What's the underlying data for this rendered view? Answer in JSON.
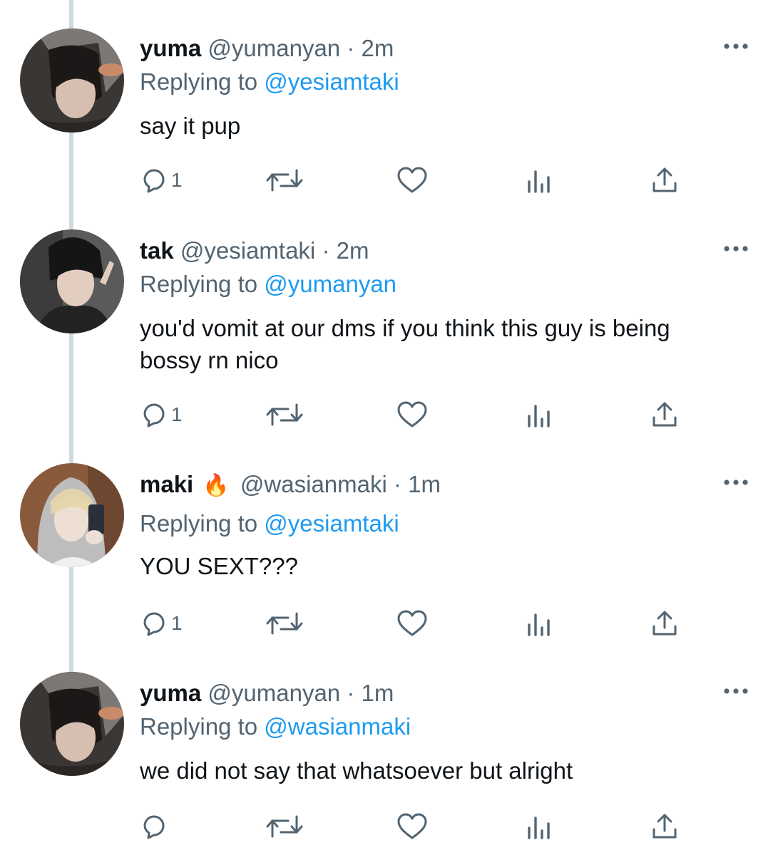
{
  "tweets": [
    {
      "name": "yuma",
      "handle": "@yumanyan",
      "time": "2m",
      "replying_prefix": "Replying to",
      "replying_to": "@yesiamtaki",
      "text": "say it pup",
      "reply_count": "1",
      "avatar": "photo of dark-haired person in grey hoodie"
    },
    {
      "name": "tak",
      "handle": "@yesiamtaki",
      "time": "2m",
      "replying_prefix": "Replying to",
      "replying_to": "@yumanyan",
      "text": "you'd vomit at our dms if you think this guy is being bossy rn nico",
      "reply_count": "1",
      "avatar": "photo of dark-haired person making peace sign"
    },
    {
      "name": "maki",
      "name_emoji": "🔥",
      "handle": "@wasianmaki",
      "time": "1m",
      "replying_prefix": "Replying to",
      "replying_to": "@yesiamtaki",
      "text": "YOU SEXT???",
      "reply_count": "1",
      "avatar": "mirror selfie of blond person in grey hoodie"
    },
    {
      "name": "yuma",
      "handle": "@yumanyan",
      "time": "1m",
      "replying_prefix": "Replying to",
      "replying_to": "@wasianmaki",
      "text": "we did not say that whatsoever but alright",
      "reply_count": "",
      "avatar": "photo of dark-haired person in grey hoodie"
    }
  ],
  "separator": "·",
  "icons": [
    "reply-icon",
    "retweet-icon",
    "like-icon",
    "views-icon",
    "share-icon",
    "more-icon"
  ],
  "colors": {
    "text": "#0f1419",
    "secondary": "#536471",
    "link": "#1d9bf0",
    "thread_line": "#cfd9de"
  }
}
